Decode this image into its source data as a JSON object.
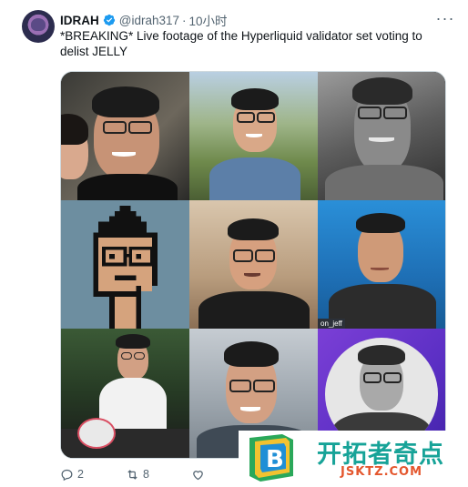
{
  "tweet": {
    "name": "IDRAH",
    "handle": "@idrah317",
    "separator": "·",
    "time": "10小时",
    "more_glyph": "···",
    "text": "*BREAKING* Live footage of the Hyperliquid validator set voting to delist JELLY",
    "media": {
      "grid": "3x3 photo collage",
      "tile_label": "on_jeff"
    }
  },
  "actions": {
    "reply_count": "2",
    "retweet_count": "8",
    "like_count": ""
  },
  "watermark": {
    "logo_letter": "B",
    "chinese_text": "开拓者奇点",
    "latin_text": "JSKTZ.COM"
  },
  "colors": {
    "verified": "#1d9bf0",
    "secondary_text": "#536471",
    "border": "#cfd9de",
    "watermark_teal": "#17a398",
    "watermark_orange": "#e4572e"
  },
  "icons": [
    "verified-badge-icon",
    "more-icon",
    "reply-icon",
    "retweet-icon",
    "like-icon"
  ]
}
